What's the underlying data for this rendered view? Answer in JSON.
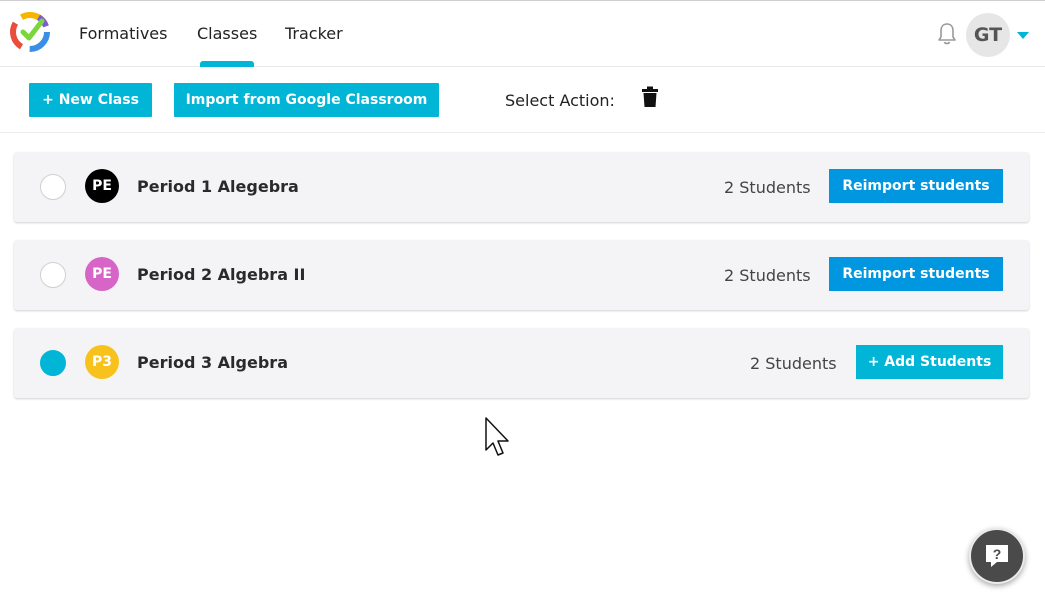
{
  "nav": {
    "items": [
      {
        "label": "Formatives"
      },
      {
        "label": "Classes",
        "active": true
      },
      {
        "label": "Tracker"
      }
    ],
    "avatar_initials": "GT",
    "icons": {
      "logo": "formative-logo-icon",
      "bell": "bell-icon",
      "caret": "caret-down-icon"
    }
  },
  "actions": {
    "new_class_label": "+ New Class",
    "import_label": "Import from Google Classroom",
    "select_action_label": "Select Action:",
    "trash_icon": "trash-icon"
  },
  "classes": [
    {
      "badge": "PE",
      "badge_color": "#000000",
      "name": "Period 1 Alegebra",
      "students": "2 Students",
      "button": "Reimport students",
      "selected": false
    },
    {
      "badge": "PE",
      "badge_color": "#d765c8",
      "name": "Period 2 Algebra II",
      "students": "2 Students",
      "button": "Reimport students",
      "selected": false
    },
    {
      "badge": "P3",
      "badge_color": "#f7c21c",
      "name": "Period 3 Algebra",
      "students": "2 Students",
      "button": "+ Add Students",
      "selected": true
    }
  ],
  "help_icon": "help-chat-icon",
  "colors": {
    "accent": "#00b5d6",
    "reimport": "#0096e0"
  }
}
